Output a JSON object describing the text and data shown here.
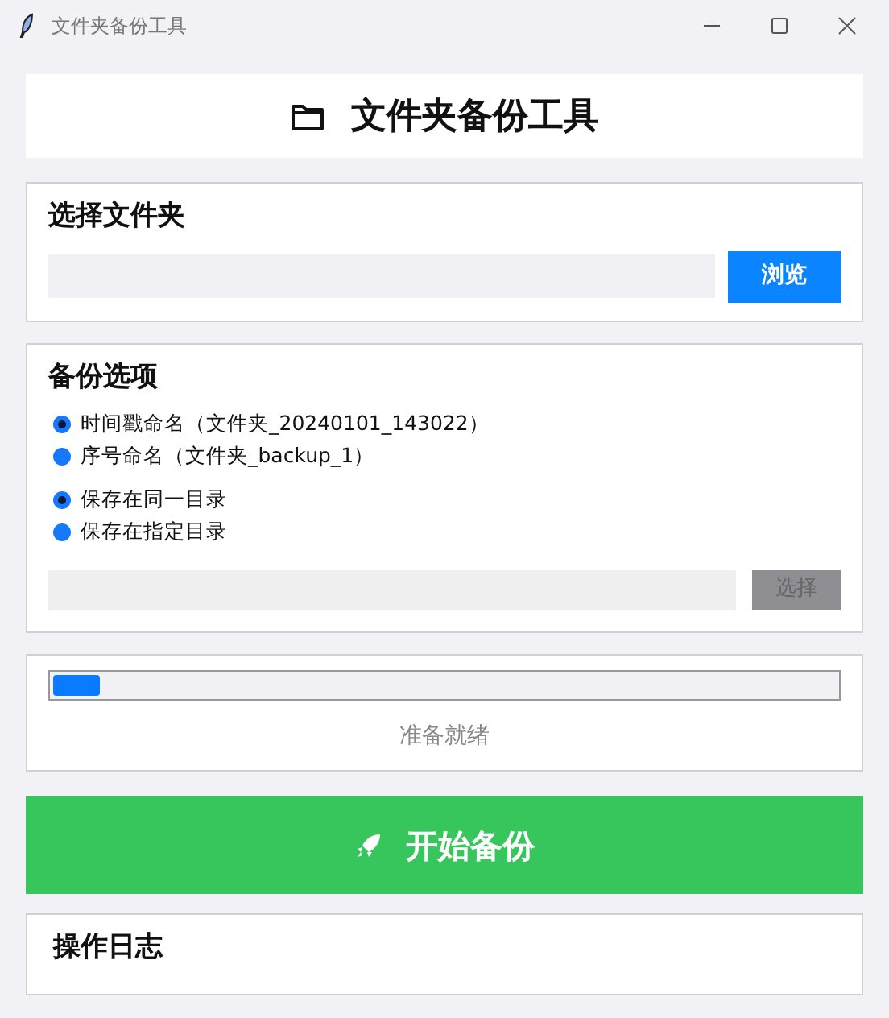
{
  "window": {
    "title": "文件夹备份工具"
  },
  "header": {
    "title": "文件夹备份工具"
  },
  "folder_section": {
    "title": "选择文件夹",
    "browse_button": "浏览"
  },
  "options_section": {
    "title": "备份选项",
    "naming": [
      {
        "label": "时间戳命名（文件夹_20240101_143022）",
        "selected": true
      },
      {
        "label": "序号命名（文件夹_backup_1）",
        "selected": false
      }
    ],
    "location": [
      {
        "label": "保存在同一目录",
        "selected": true
      },
      {
        "label": "保存在指定目录",
        "selected": false
      }
    ],
    "target_field": {
      "disabled": true
    },
    "choose_button": {
      "label": "选择",
      "disabled": true
    }
  },
  "progress": {
    "level": 0.06,
    "status": "准备就绪"
  },
  "start_button": "开始备份",
  "log_section": {
    "title": "操作日志"
  }
}
